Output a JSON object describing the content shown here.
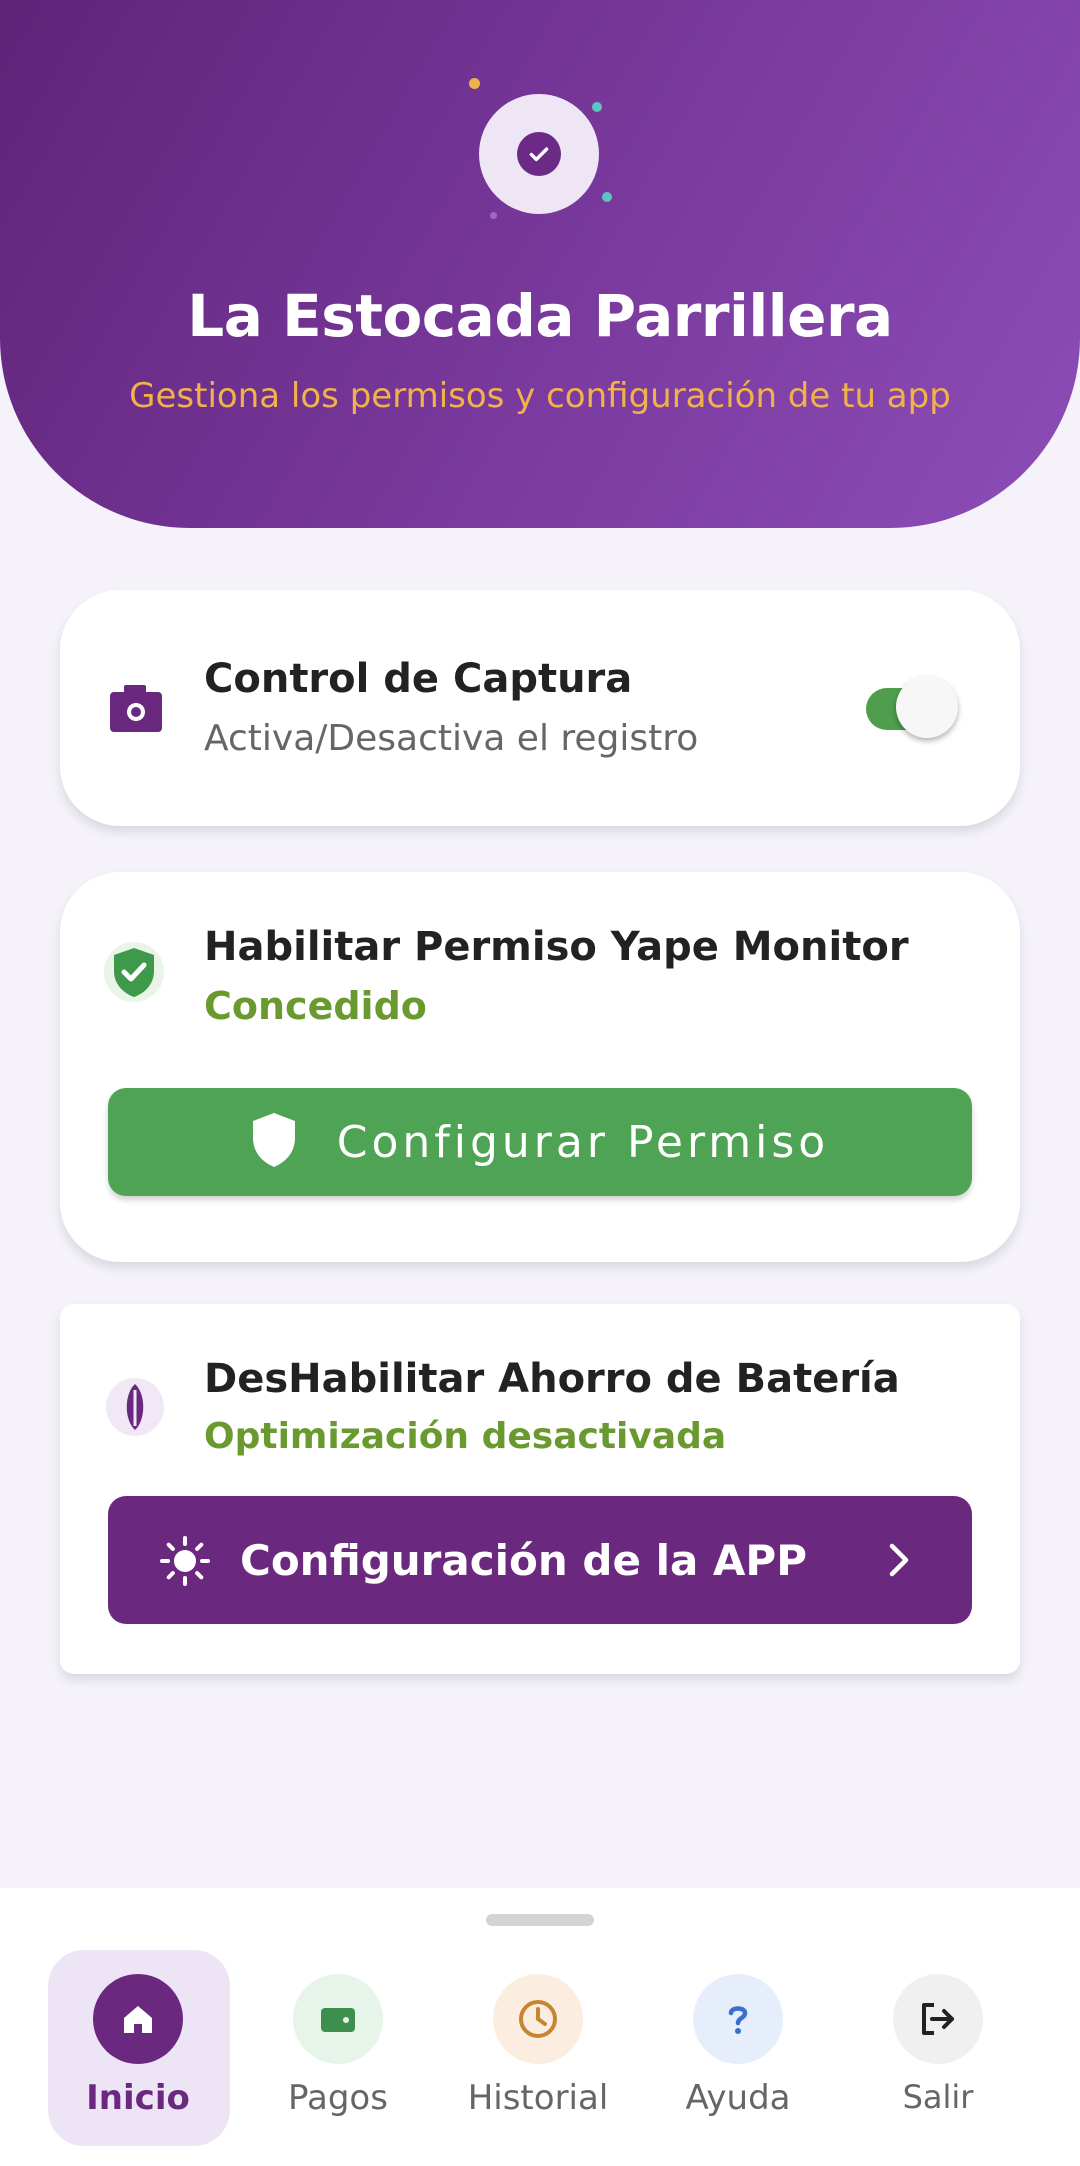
{
  "header": {
    "title": "La Estocada Parrillera",
    "subtitle": "Gestiona los permisos y configuración de tu app",
    "logo_icon": "check-badge-icon"
  },
  "cards": {
    "capture": {
      "icon": "camera-icon",
      "title": "Control de Captura",
      "subtitle": "Activa/Desactiva el registro",
      "toggle_on": true
    },
    "permission": {
      "icon": "shield-check-icon",
      "title": "Habilitar Permiso Yape Monitor",
      "status": "Concedido",
      "button_label": "Configurar Permiso",
      "button_icon": "shield-icon"
    },
    "battery": {
      "icon": "leaf-icon",
      "title": "DesHabilitar Ahorro de Batería",
      "status": "Optimización desactivada",
      "button_label": "Configuración de la APP",
      "button_icon": "sun-icon",
      "button_trailing_icon": "chevron-right-icon"
    }
  },
  "nav": {
    "items": [
      {
        "label": "Inicio",
        "icon": "home-icon",
        "active": true
      },
      {
        "label": "Pagos",
        "icon": "wallet-icon"
      },
      {
        "label": "Historial",
        "icon": "clock-icon"
      },
      {
        "label": "Ayuda",
        "icon": "help-icon"
      },
      {
        "label": "Salir",
        "icon": "logout-icon"
      }
    ]
  },
  "colors": {
    "primary": "#6A297F",
    "success": "#4FA354",
    "status_text": "#6A9A2F",
    "accent": "#F2B24B"
  }
}
